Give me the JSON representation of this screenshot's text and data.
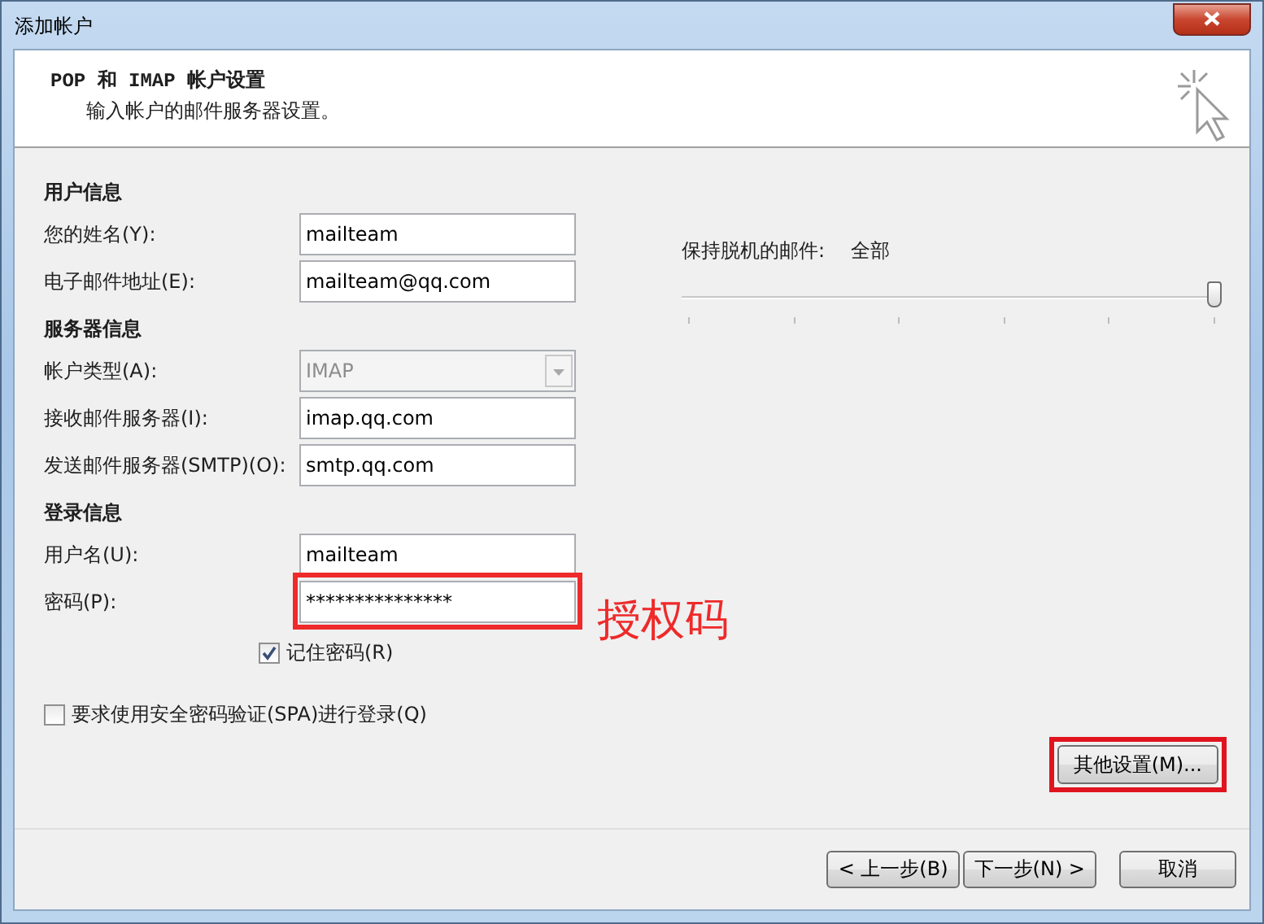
{
  "window": {
    "title": "添加帐户"
  },
  "header": {
    "title": "POP 和 IMAP 帐户设置",
    "subtitle": "输入帐户的邮件服务器设置。"
  },
  "sections": [
    {
      "heading": "用户信息",
      "fields": [
        {
          "kind": "text",
          "label": "您的姓名(Y):",
          "value": "mailteam",
          "disabled": false,
          "highlighted": false
        },
        {
          "kind": "text",
          "label": "电子邮件地址(E):",
          "value": "mailteam@qq.com",
          "disabled": false,
          "highlighted": false
        }
      ]
    },
    {
      "heading": "服务器信息",
      "fields": [
        {
          "kind": "select",
          "label": "帐户类型(A):",
          "value": "IMAP",
          "disabled": true,
          "highlighted": false
        },
        {
          "kind": "text",
          "label": "接收邮件服务器(I):",
          "value": "imap.qq.com",
          "disabled": false,
          "highlighted": false
        },
        {
          "kind": "text",
          "label": "发送邮件服务器(SMTP)(O):",
          "value": "smtp.qq.com",
          "disabled": false,
          "highlighted": false
        }
      ]
    },
    {
      "heading": "登录信息",
      "fields": [
        {
          "kind": "text",
          "label": "用户名(U):",
          "value": "mailteam",
          "disabled": false,
          "highlighted": false
        },
        {
          "kind": "password",
          "label": "密码(P):",
          "value": "***************",
          "disabled": false,
          "highlighted": true
        }
      ]
    }
  ],
  "remember_password": {
    "label": "记住密码(R)",
    "checked": true
  },
  "annotation": {
    "text": "授权码"
  },
  "spa": {
    "label": "要求使用安全密码验证(SPA)进行登录(Q)",
    "checked": false
  },
  "offline": {
    "label": "保持脱机的邮件:",
    "reading": "全部",
    "level": 1
  },
  "more_settings_button": {
    "label": "其他设置(M)...",
    "highlighted": true
  },
  "buttons": [
    {
      "label": "< 上一步(B)"
    },
    {
      "label": "下一步(N) >"
    },
    {
      "label": "取消"
    }
  ]
}
